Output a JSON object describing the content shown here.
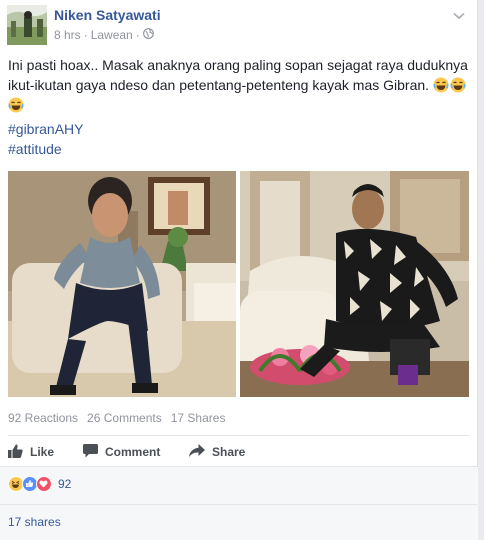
{
  "post": {
    "author": "Niken Satyawati",
    "time": "8 hrs",
    "location": "Lawean",
    "separator": "·",
    "audience_icon": "globe-icon",
    "text": "Ini pasti hoax.. Masak anaknya orang paling sopan sejagat raya duduknya ikut-ikutan gaya ndeso dan petentang-petenteng kayak mas Gibran.",
    "text_emojis": [
      "joy-emoji",
      "joy-emoji",
      "joy-emoji"
    ],
    "hashtags": [
      "#gibranAHY",
      "#attitude"
    ],
    "photos": [
      "photo-seated-young-man",
      "photo-seated-man-batik-shirt"
    ]
  },
  "stats": {
    "reactions": "92 Reactions",
    "comments": "26 Comments",
    "shares": "17 Shares"
  },
  "actions": {
    "like": "Like",
    "comment": "Comment",
    "share": "Share"
  },
  "reactions_summary": {
    "icons": [
      "haha-icon",
      "like-icon",
      "love-icon"
    ],
    "count": "92"
  },
  "shares_link": "17 shares",
  "colors": {
    "link": "#365899",
    "meta": "#90949c",
    "action": "#4b4f56",
    "like_blue": "#5890ff",
    "love_red": "#f25268",
    "haha_yellow": "#fcc84e"
  }
}
